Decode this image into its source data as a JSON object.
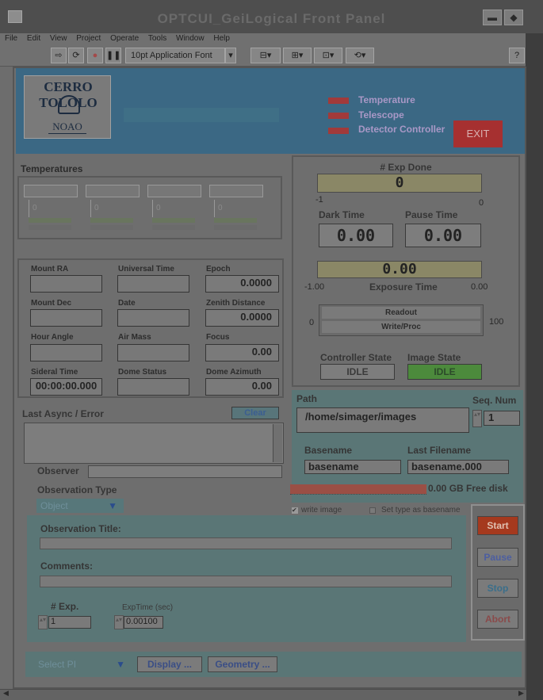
{
  "window": {
    "title": "OPTCUI_GeiLogical Front Panel"
  },
  "menu": [
    "File",
    "Edit",
    "View",
    "Project",
    "Operate",
    "Tools",
    "Window",
    "Help"
  ],
  "toolbar": {
    "font_select": "10pt Application Font",
    "help_glyph": "?"
  },
  "header": {
    "logo_arc": "CERRO TOLOLO",
    "logo_sub": "NOAO",
    "indicators": [
      "Temperature",
      "Telescope",
      "Detector Controller"
    ],
    "exit_label": "EXIT"
  },
  "temperatures": {
    "title": "Temperatures",
    "values": [
      "0",
      "0",
      "0",
      "0"
    ]
  },
  "telescope": {
    "mount_ra": {
      "label": "Mount RA",
      "value": ""
    },
    "universal_time": {
      "label": "Universal Time",
      "value": ""
    },
    "epoch": {
      "label": "Epoch",
      "value": "0.0000"
    },
    "mount_dec": {
      "label": "Mount Dec",
      "value": ""
    },
    "date": {
      "label": "Date",
      "value": ""
    },
    "zenith_distance": {
      "label": "Zenith Distance",
      "value": "0.0000"
    },
    "hour_angle": {
      "label": "Hour Angle",
      "value": ""
    },
    "air_mass": {
      "label": "Air Mass",
      "value": ""
    },
    "focus": {
      "label": "Focus",
      "value": "0.00"
    },
    "sideral_time": {
      "label": "Sideral Time",
      "value": "00:00:00.000"
    },
    "dome_status": {
      "label": "Dome Status",
      "value": ""
    },
    "dome_azimuth": {
      "label": "Dome Azimuth",
      "value": "0.00"
    }
  },
  "exposure": {
    "exp_done_label": "# Exp Done",
    "exp_done_value": "0",
    "exp_done_min": "-1",
    "exp_done_max": "0",
    "dark_time_label": "Dark Time",
    "dark_time_value": "0.00",
    "pause_time_label": "Pause Time",
    "pause_time_value": "0.00",
    "exposure_time_value": "0.00",
    "exposure_time_label": "Exposure Time",
    "exposure_min": "-1.00",
    "exposure_max": "0.00",
    "readout_label": "Readout",
    "writeproc_label": "Write/Proc",
    "progress_min": "0",
    "progress_max": "100",
    "controller_state_label": "Controller State",
    "controller_state_value": "IDLE",
    "image_state_label": "Image State",
    "image_state_value": "IDLE"
  },
  "async": {
    "label": "Last Async / Error",
    "clear_label": "Clear",
    "text": ""
  },
  "files": {
    "path_label": "Path",
    "path_value": "/home/simager/images",
    "seq_label": "Seq. Num",
    "seq_value": "1",
    "basename_label": "Basename",
    "basename_value": "basename",
    "lastfile_label": "Last Filename",
    "lastfile_value": "basename.000",
    "free_disk": "0.00 GB Free disk",
    "write_image_label": "write image",
    "set_type_label": "Set type as basename"
  },
  "observer": {
    "label": "Observer",
    "value": "",
    "obs_type_label": "Observation Type",
    "obs_type_value": "Object"
  },
  "observation": {
    "title_label": "Observation Title:",
    "title_value": "",
    "comments_label": "Comments:",
    "comments_value": "",
    "num_exp_label": "# Exp.",
    "num_exp_value": "1",
    "exptime_label": "ExpTime (sec)",
    "exptime_value": "0.00100"
  },
  "controls": {
    "start": "Start",
    "pause": "Pause",
    "stop": "Stop",
    "abort": "Abort"
  },
  "bottom": {
    "select_pi": "Select PI",
    "display": "Display ...",
    "geometry": "Geometry ..."
  },
  "colors": {
    "header_blue": "#3b6884",
    "led_red": "#a13a3a",
    "exit_red": "#a63030",
    "idle_green": "#4c8a3c",
    "teal_panel": "#5a7676",
    "start_red": "#a5391e"
  }
}
